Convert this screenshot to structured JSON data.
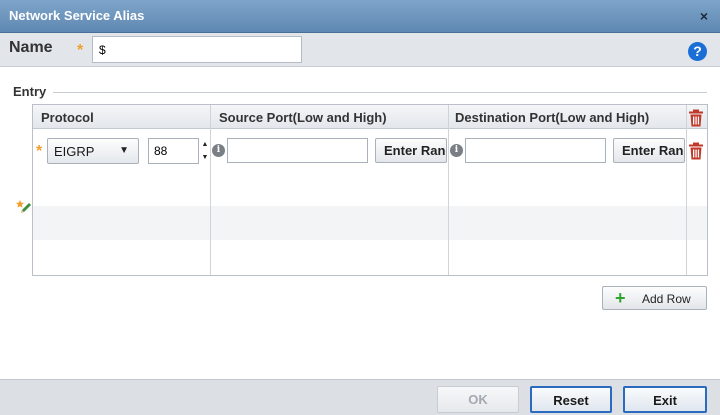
{
  "dialog": {
    "title": "Network Service Alias",
    "close_glyph": "×"
  },
  "name_field": {
    "label": "Name",
    "required_marker": "*",
    "value": "$"
  },
  "help": {
    "glyph": "?",
    "icon": "help-icon",
    "color": "#1a6fd6"
  },
  "entry": {
    "label": "Entry",
    "columns": {
      "protocol": "Protocol",
      "source_port": "Source Port(Low and High)",
      "destination_port": "Destination Port(Low and High)"
    },
    "row": {
      "required_marker": "*",
      "protocol_selected": "EIGRP",
      "dropdown_glyph": "▼",
      "protocol_number": "88",
      "spinner_up": "▲",
      "spinner_down": "▼",
      "info_glyph": "i",
      "source_port_value": "",
      "source_range_button": "Enter Range",
      "destination_port_value": "",
      "destination_range_button": "Enter Range"
    },
    "icons": {
      "delete": "trash-icon",
      "edit": "edit-pencil-icon",
      "info": "info-icon"
    }
  },
  "add_row": {
    "glyph": "+",
    "label": "Add Row"
  },
  "footer": {
    "ok_label": "OK",
    "reset_label": "Reset",
    "exit_label": "Exit"
  },
  "colors": {
    "titlebar": "#6d96bf",
    "accent_border": "#2a6bc0",
    "required": "#f0a030",
    "delete": "#c0392b",
    "add": "#2fa52f"
  }
}
